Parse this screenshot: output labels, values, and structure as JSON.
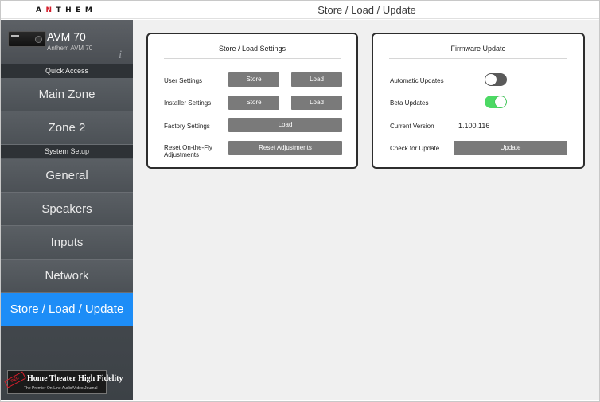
{
  "brand": {
    "logo_text": "ANTHEM",
    "accent_color": "#d41e2b"
  },
  "header": {
    "title": "Store / Load / Update"
  },
  "device": {
    "name": "AVM 70",
    "subtitle": "Anthem AVM 70",
    "info_icon": "info-icon"
  },
  "sidebar": {
    "quick_access_label": "Quick Access",
    "system_setup_label": "System Setup",
    "items": [
      {
        "label": "Main Zone"
      },
      {
        "label": "Zone 2"
      },
      {
        "label": "General"
      },
      {
        "label": "Speakers"
      },
      {
        "label": "Inputs"
      },
      {
        "label": "Network"
      },
      {
        "label": "Store / Load / Update",
        "active": true
      }
    ],
    "active_color": "#1d8df7"
  },
  "badge": {
    "title": "Home Theater High Fidelity",
    "subtitle": "The Premier On-Line Audio/Video Journal",
    "stamp": "RECOMMENDED"
  },
  "store_load": {
    "title": "Store / Load Settings",
    "rows": [
      {
        "label": "User Settings",
        "store": "Store",
        "load": "Load"
      },
      {
        "label": "Installer Settings",
        "store": "Store",
        "load": "Load"
      }
    ],
    "factory": {
      "label": "Factory Settings",
      "button": "Load"
    },
    "reset": {
      "label": "Reset On-the-Fly Adjustments",
      "button": "Reset Adjustments"
    }
  },
  "firmware": {
    "title": "Firmware Update",
    "automatic_updates": {
      "label": "Automatic Updates",
      "enabled": false
    },
    "beta_updates": {
      "label": "Beta Updates",
      "enabled": true
    },
    "current_version": {
      "label": "Current Version",
      "value": "1.100.116"
    },
    "check": {
      "label": "Check for Update",
      "button": "Update"
    },
    "toggle_on_color": "#4cd964"
  }
}
